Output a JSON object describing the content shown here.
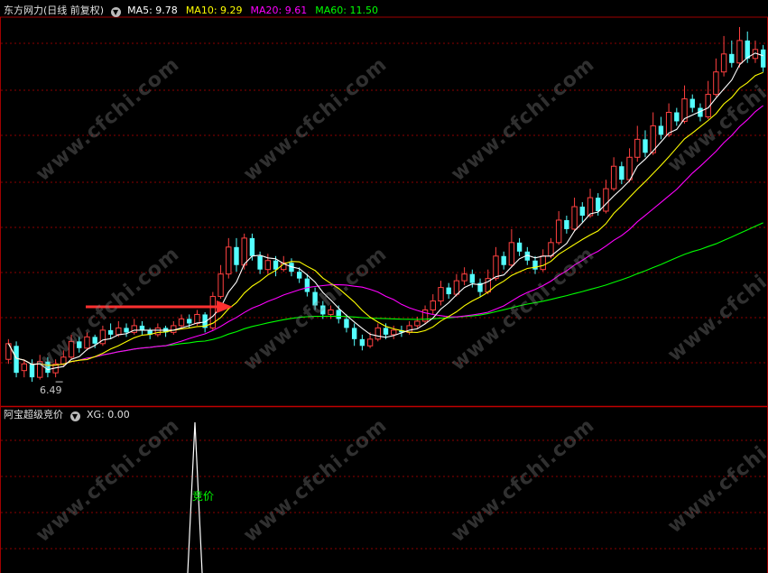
{
  "main_header": {
    "title": "东方网力(日线 前复权)",
    "indicators": [
      {
        "label": "MA5: 9.78",
        "color": "#ffffff"
      },
      {
        "label": "MA10: 9.29",
        "color": "#ffff00"
      },
      {
        "label": "MA20: 9.61",
        "color": "#ff00ff"
      },
      {
        "label": "MA60: 11.50",
        "color": "#00ff00"
      }
    ]
  },
  "sub_header": {
    "title": "阿宝超级竞价",
    "indicator": "XG: 0.00"
  },
  "low_label": "6.49",
  "signal_label": "竞价",
  "watermark": "www.cfchi.com",
  "colors": {
    "up": "#ff4040",
    "down": "#54ffff",
    "ma5": "#ffffff",
    "ma10": "#ffff00",
    "ma20": "#ff00ff",
    "ma60": "#00ff00",
    "grid": "#8b0000",
    "arrow": "#ff3030",
    "signal": "#ffffff",
    "signal_label": "#00ff00"
  },
  "chart_data": {
    "type": "candlestick",
    "ylim": [
      6.0,
      14.6
    ],
    "candles": [
      [
        7.0,
        7.35,
        6.9,
        7.45
      ],
      [
        7.3,
        6.7,
        6.6,
        7.4
      ],
      [
        6.75,
        6.9,
        6.6,
        7.0
      ],
      [
        6.9,
        6.6,
        6.5,
        7.0
      ],
      [
        6.6,
        6.95,
        6.55,
        7.1
      ],
      [
        6.95,
        6.7,
        6.6,
        7.05
      ],
      [
        6.7,
        6.9,
        6.6,
        7.0
      ],
      [
        6.9,
        7.05,
        6.85,
        7.2
      ],
      [
        7.05,
        7.4,
        7.0,
        7.55
      ],
      [
        7.4,
        7.25,
        7.15,
        7.5
      ],
      [
        7.25,
        7.5,
        7.2,
        7.6
      ],
      [
        7.5,
        7.35,
        7.25,
        7.55
      ],
      [
        7.35,
        7.65,
        7.3,
        7.75
      ],
      [
        7.65,
        7.55,
        7.45,
        7.8
      ],
      [
        7.55,
        7.7,
        7.5,
        7.85
      ],
      [
        7.7,
        7.6,
        7.5,
        7.8
      ],
      [
        7.6,
        7.75,
        7.55,
        7.9
      ],
      [
        7.75,
        7.65,
        7.55,
        7.85
      ],
      [
        7.65,
        7.55,
        7.45,
        7.7
      ],
      [
        7.55,
        7.7,
        7.5,
        7.8
      ],
      [
        7.7,
        7.6,
        7.5,
        7.75
      ],
      [
        7.6,
        7.75,
        7.55,
        7.85
      ],
      [
        7.75,
        7.9,
        7.7,
        8.0
      ],
      [
        7.9,
        7.8,
        7.7,
        8.0
      ],
      [
        7.8,
        8.0,
        7.75,
        8.1
      ],
      [
        8.0,
        7.7,
        7.6,
        8.05
      ],
      [
        7.7,
        8.4,
        7.65,
        8.5
      ],
      [
        8.4,
        8.9,
        8.35,
        9.1
      ],
      [
        8.9,
        9.5,
        8.8,
        9.7
      ],
      [
        9.5,
        9.1,
        8.95,
        9.7
      ],
      [
        9.1,
        9.7,
        9.0,
        9.8
      ],
      [
        9.7,
        9.3,
        9.2,
        9.8
      ],
      [
        9.3,
        9.0,
        8.9,
        9.4
      ],
      [
        9.0,
        9.2,
        8.9,
        9.35
      ],
      [
        9.2,
        9.0,
        8.85,
        9.3
      ],
      [
        9.0,
        9.15,
        8.95,
        9.3
      ],
      [
        9.15,
        8.95,
        8.85,
        9.25
      ],
      [
        8.95,
        8.8,
        8.7,
        9.05
      ],
      [
        8.8,
        8.5,
        8.4,
        8.9
      ],
      [
        8.5,
        8.2,
        8.1,
        8.6
      ],
      [
        8.2,
        8.0,
        7.9,
        8.3
      ],
      [
        8.0,
        8.1,
        7.9,
        8.2
      ],
      [
        8.1,
        7.9,
        7.8,
        8.2
      ],
      [
        7.9,
        7.7,
        7.6,
        8.0
      ],
      [
        7.7,
        7.45,
        7.3,
        7.8
      ],
      [
        7.45,
        7.3,
        7.2,
        7.55
      ],
      [
        7.3,
        7.45,
        7.25,
        7.6
      ],
      [
        7.45,
        7.7,
        7.4,
        7.8
      ],
      [
        7.7,
        7.55,
        7.45,
        7.8
      ],
      [
        7.55,
        7.65,
        7.45,
        7.75
      ],
      [
        7.65,
        7.6,
        7.5,
        7.75
      ],
      [
        7.6,
        7.75,
        7.55,
        7.85
      ],
      [
        7.75,
        7.85,
        7.7,
        7.95
      ],
      [
        7.85,
        8.1,
        7.8,
        8.2
      ],
      [
        8.1,
        8.3,
        8.0,
        8.45
      ],
      [
        8.3,
        8.6,
        8.2,
        8.75
      ],
      [
        8.6,
        8.45,
        8.35,
        8.7
      ],
      [
        8.45,
        8.75,
        8.4,
        8.9
      ],
      [
        8.75,
        8.9,
        8.65,
        9.05
      ],
      [
        8.9,
        8.7,
        8.6,
        9.0
      ],
      [
        8.7,
        8.5,
        8.4,
        8.8
      ],
      [
        8.5,
        8.8,
        8.45,
        9.0
      ],
      [
        8.8,
        9.3,
        8.75,
        9.5
      ],
      [
        9.3,
        9.1,
        9.0,
        9.4
      ],
      [
        9.1,
        9.6,
        9.05,
        9.9
      ],
      [
        9.6,
        9.4,
        9.3,
        9.7
      ],
      [
        9.4,
        9.2,
        9.1,
        9.5
      ],
      [
        9.2,
        9.0,
        8.9,
        9.3
      ],
      [
        9.0,
        9.3,
        8.95,
        9.45
      ],
      [
        9.3,
        9.6,
        9.25,
        9.7
      ],
      [
        9.6,
        10.1,
        9.55,
        10.3
      ],
      [
        10.1,
        9.9,
        9.8,
        10.2
      ],
      [
        9.9,
        10.4,
        9.85,
        10.6
      ],
      [
        10.4,
        10.2,
        10.05,
        10.5
      ],
      [
        10.2,
        10.6,
        10.15,
        10.8
      ],
      [
        10.6,
        10.3,
        10.2,
        10.7
      ],
      [
        10.3,
        10.8,
        10.25,
        11.0
      ],
      [
        10.8,
        11.3,
        10.75,
        11.5
      ],
      [
        11.3,
        11.0,
        10.9,
        11.4
      ],
      [
        11.0,
        11.5,
        10.95,
        11.7
      ],
      [
        11.5,
        11.9,
        11.4,
        12.2
      ],
      [
        11.9,
        11.6,
        11.5,
        12.1
      ],
      [
        11.6,
        12.2,
        11.55,
        12.5
      ],
      [
        12.2,
        12.0,
        11.9,
        12.4
      ],
      [
        12.0,
        12.5,
        11.95,
        12.7
      ],
      [
        12.5,
        12.3,
        12.2,
        12.6
      ],
      [
        12.3,
        12.8,
        12.25,
        13.1
      ],
      [
        12.8,
        12.6,
        12.5,
        12.9
      ],
      [
        12.6,
        12.4,
        12.3,
        12.7
      ],
      [
        12.4,
        12.9,
        12.35,
        13.2
      ],
      [
        12.9,
        13.4,
        12.85,
        13.7
      ],
      [
        13.4,
        13.8,
        13.3,
        14.2
      ],
      [
        13.8,
        13.6,
        13.5,
        14.1
      ],
      [
        13.6,
        14.1,
        13.5,
        14.4
      ],
      [
        14.1,
        13.7,
        13.6,
        14.3
      ],
      [
        13.7,
        13.9,
        13.6,
        14.1
      ],
      [
        13.9,
        13.5,
        13.4,
        14.0
      ]
    ]
  }
}
